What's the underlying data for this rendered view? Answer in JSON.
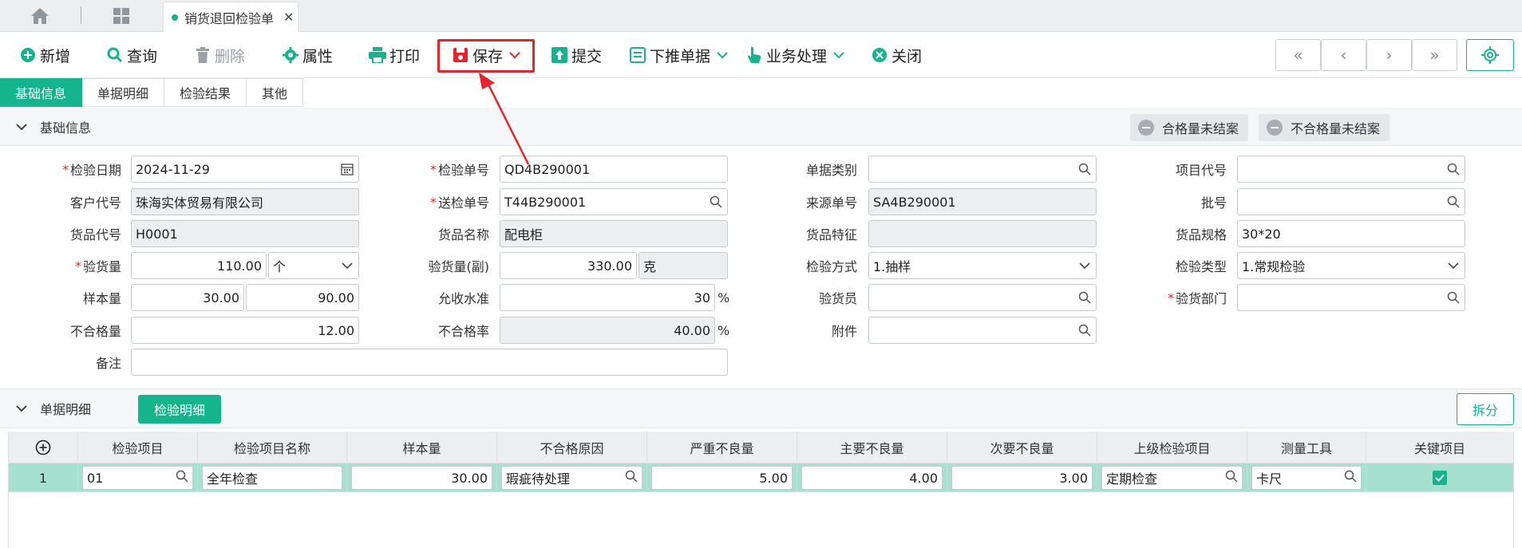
{
  "tabbar": {
    "active_tab": "销货退回检验单",
    "close": "✕"
  },
  "toolbar": {
    "add": "新增",
    "query": "查询",
    "delete": "删除",
    "props": "属性",
    "print": "打印",
    "save": "保存",
    "submit": "提交",
    "push": "下推单据",
    "business": "业务处理",
    "close": "关闭",
    "nav_first": "«",
    "nav_prev": "‹",
    "nav_next": "›",
    "nav_last": "»"
  },
  "subtabs": [
    "基础信息",
    "单据明细",
    "检验结果",
    "其他"
  ],
  "basic": {
    "section_title": "基础信息",
    "pill1": "合格量未结案",
    "pill2": "不合格量未结案",
    "labels": {
      "inspect_date": "检验日期",
      "inspect_no": "检验单号",
      "doc_type": "单据类别",
      "project_code": "项目代号",
      "customer_code": "客户代号",
      "send_no": "送检单号",
      "source_no": "来源单号",
      "batch": "批号",
      "goods_code": "货品代号",
      "goods_name": "货品名称",
      "goods_feature": "货品特征",
      "goods_spec": "货品规格",
      "inspect_qty": "验货量",
      "inspect_qty_sub": "验货量(副)",
      "inspect_method": "检验方式",
      "inspect_type": "检验类型",
      "sample_qty": "样本量",
      "accept_level": "允收水准",
      "inspector": "验货员",
      "inspect_dept": "验货部门",
      "reject_qty": "不合格量",
      "reject_rate": "不合格率",
      "attachment": "附件",
      "remark": "备注"
    },
    "values": {
      "inspect_date": "2024-11-29",
      "inspect_no": "QD4B290001",
      "doc_type": "",
      "project_code": "",
      "customer_code": "珠海实体贸易有限公司",
      "send_no": "T44B290001",
      "source_no": "SA4B290001",
      "batch": "",
      "goods_code": "H0001",
      "goods_name": "配电柜",
      "goods_feature": "",
      "goods_spec": "30*20",
      "inspect_qty": "110.00",
      "inspect_unit": "个",
      "inspect_qty_sub": "330.00",
      "inspect_unit_sub": "克",
      "inspect_method": "1.抽样",
      "inspect_type": "1.常规检验",
      "sample_qty": "30.00",
      "sample_qty2": "90.00",
      "accept_level": "30",
      "percent": "%",
      "inspector": "",
      "inspect_dept": "",
      "reject_qty": "12.00",
      "reject_rate": "40.00",
      "attachment": "",
      "remark": ""
    }
  },
  "detail": {
    "section_title": "单据明细",
    "tab": "检验明细",
    "split": "拆分",
    "columns": [
      "检验项目",
      "检验项目名称",
      "样本量",
      "不合格原因",
      "严重不良量",
      "主要不良量",
      "次要不良量",
      "上级检验项目",
      "测量工具",
      "关键项目"
    ],
    "rows": [
      {
        "no": "1",
        "item": "01",
        "item_name": "全年检查",
        "sample": "30.00",
        "reason": "瑕疵待处理",
        "severe": "5.00",
        "major": "4.00",
        "minor": "3.00",
        "parent": "定期检查",
        "tool": "卡尺",
        "key": true
      }
    ]
  },
  "colors": {
    "accent": "#14b48c",
    "highlight": "#e8232b",
    "row": "#a6e0cf"
  }
}
